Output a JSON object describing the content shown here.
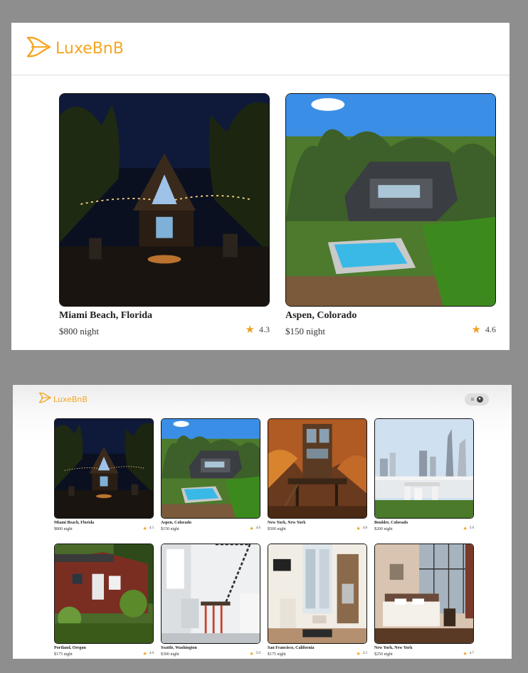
{
  "brand": {
    "name": "LuxeBnB",
    "color": "#f5a623"
  },
  "icons": {
    "logo": "wings-logo-icon",
    "rating": "star-icon",
    "menu": "hamburger-icon",
    "account": "user-icon"
  },
  "top_view": {
    "listings": [
      {
        "location": "Miami Beach, Florida",
        "price": "$800 night",
        "rating": "4.3"
      },
      {
        "location": "Aspen, Colorado",
        "price": "$150 night",
        "rating": "4.6"
      }
    ]
  },
  "bottom_view": {
    "menu_label": "≡",
    "listings": [
      {
        "location": "Miami Beach, Florida",
        "price": "$800 night",
        "rating": "4.3"
      },
      {
        "location": "Aspen, Colorado",
        "price": "$150 night",
        "rating": "4.6"
      },
      {
        "location": "New York, New York",
        "price": "$500 night",
        "rating": "4.8"
      },
      {
        "location": "Boulder, Colorado",
        "price": "$200 night",
        "rating": "5.0"
      },
      {
        "location": "Portland, Oregon",
        "price": "$175 night",
        "rating": "4.0"
      },
      {
        "location": "Seattle, Washington",
        "price": "$300 night",
        "rating": "5.0"
      },
      {
        "location": "San Francisco, California",
        "price": "$175 night",
        "rating": "4.3"
      },
      {
        "location": "New York, New York",
        "price": "$250 night",
        "rating": "4.7"
      }
    ]
  }
}
